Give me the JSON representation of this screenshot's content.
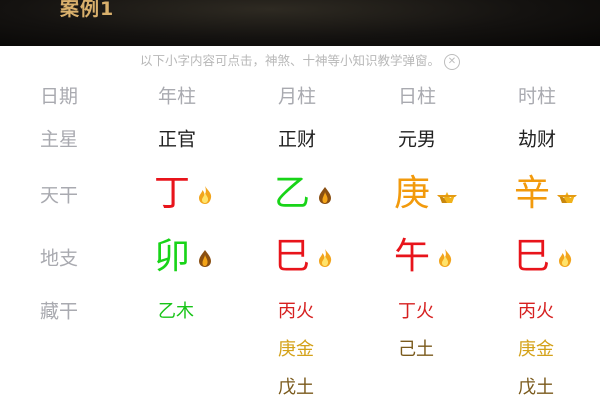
{
  "header": {
    "title": "案例1"
  },
  "notice": {
    "text": "以下小字内容可点击，神煞、十神等小知识教学弹窗。",
    "close_icon": "close-circle-icon"
  },
  "row_labels": {
    "date": "日期",
    "main_star": "主星",
    "heavenly_stem": "天干",
    "earthly_branch": "地支",
    "hidden_stem": "藏干"
  },
  "columns": [
    {
      "head": "年柱",
      "main_star": "正官",
      "stem": {
        "char": "丁",
        "color": "#e8141b",
        "icon": "fire-icon"
      },
      "branch": {
        "char": "卯",
        "color": "#18d418",
        "icon": "wood-icon"
      },
      "hidden": [
        {
          "text": "乙木",
          "color": "#18c418"
        }
      ]
    },
    {
      "head": "月柱",
      "main_star": "正财",
      "stem": {
        "char": "乙",
        "color": "#18d418",
        "icon": "wood-icon"
      },
      "branch": {
        "char": "巳",
        "color": "#e8141b",
        "icon": "fire-icon"
      },
      "hidden": [
        {
          "text": "丙火",
          "color": "#d62020"
        },
        {
          "text": "庚金",
          "color": "#d4a21a"
        },
        {
          "text": "戊土",
          "color": "#7a5a1c"
        }
      ]
    },
    {
      "head": "日柱",
      "main_star": "元男",
      "stem": {
        "char": "庚",
        "color": "#f29a0c",
        "icon": "gold-icon"
      },
      "branch": {
        "char": "午",
        "color": "#e8141b",
        "icon": "fire-icon"
      },
      "hidden": [
        {
          "text": "丁火",
          "color": "#d62020"
        },
        {
          "text": "己土",
          "color": "#7a5a1c"
        }
      ]
    },
    {
      "head": "时柱",
      "main_star": "劫财",
      "stem": {
        "char": "辛",
        "color": "#f29a0c",
        "icon": "gold-icon"
      },
      "branch": {
        "char": "巳",
        "color": "#e8141b",
        "icon": "fire-icon"
      },
      "hidden": [
        {
          "text": "丙火",
          "color": "#d62020"
        },
        {
          "text": "庚金",
          "color": "#d4a21a"
        },
        {
          "text": "戊土",
          "color": "#7a5a1c"
        }
      ]
    }
  ]
}
